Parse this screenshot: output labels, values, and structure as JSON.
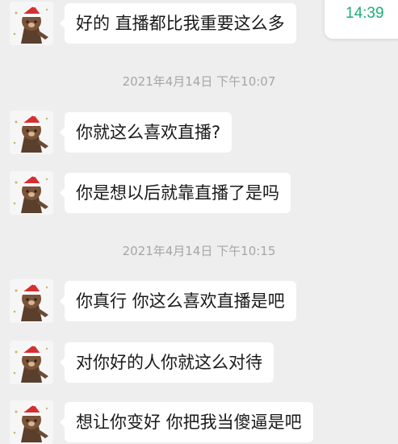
{
  "status": {
    "time": "14:39",
    "time_color": "#1aaf74"
  },
  "messages": [
    {
      "kind": "bubble",
      "text": "好的 直播都比我重要这么多"
    },
    {
      "kind": "timestamp",
      "text": "2021年4月14日 下午10:07"
    },
    {
      "kind": "bubble",
      "text": "你就这么喜欢直播?"
    },
    {
      "kind": "bubble",
      "text": "你是想以后就靠直播了是吗"
    },
    {
      "kind": "timestamp",
      "text": "2021年4月14日 下午10:15"
    },
    {
      "kind": "bubble",
      "text": "你真行 你这么喜欢直播是吧"
    },
    {
      "kind": "bubble",
      "text": "对你好的人你就这么对待"
    },
    {
      "kind": "bubble",
      "text": "想让你变好 你把我当傻逼是吧"
    }
  ],
  "avatar_icon": "brown-bear-santa-hat-icon"
}
